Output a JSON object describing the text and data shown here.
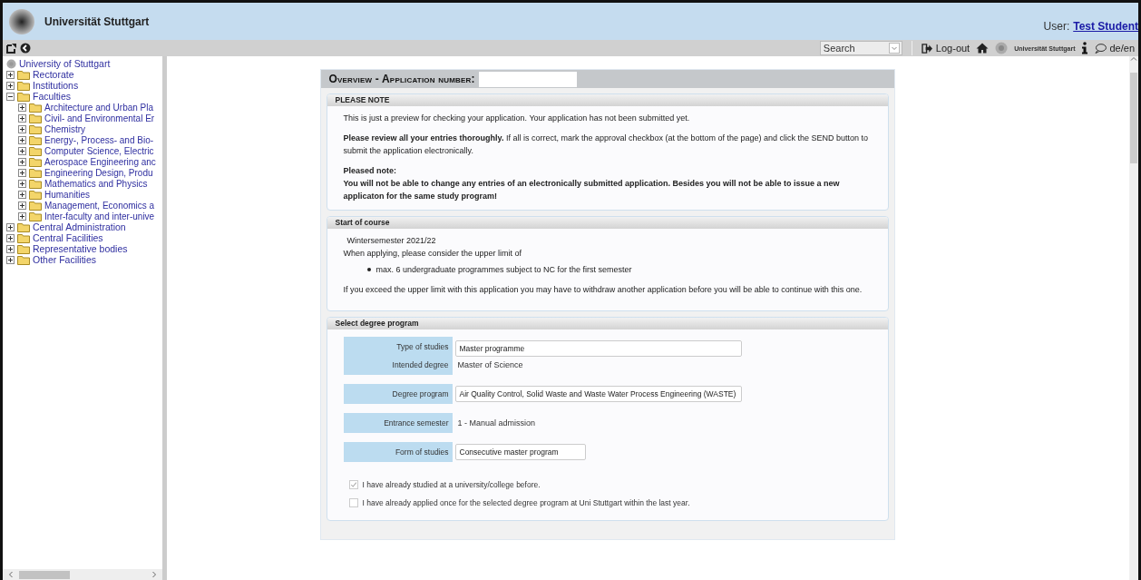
{
  "header": {
    "title": "Universität Stuttgart",
    "user_label": "User:",
    "user_name": "Test Student"
  },
  "toolbar": {
    "search": {
      "value": "Search"
    },
    "logout": "Log-out",
    "logo_text": "Universität Stuttgart",
    "language": "de/en"
  },
  "sidebar": {
    "root": "University of Stuttgart",
    "items": [
      {
        "label": "Rectorate",
        "expanded": false
      },
      {
        "label": "Institutions",
        "expanded": false
      },
      {
        "label": "Faculties",
        "expanded": true,
        "children": [
          {
            "label": "Architecture and Urban Pla",
            "expanded": false
          },
          {
            "label": "Civil- and Environmental Er",
            "expanded": false
          },
          {
            "label": "Chemistry",
            "expanded": false
          },
          {
            "label": "Energy-, Process- and Bio-",
            "expanded": false
          },
          {
            "label": "Computer Science, Electric",
            "expanded": false
          },
          {
            "label": "Aerospace Engineering anc",
            "expanded": false
          },
          {
            "label": "Engineering Design, Produ",
            "expanded": false
          },
          {
            "label": "Mathematics and Physics",
            "expanded": false
          },
          {
            "label": "Humanities",
            "expanded": false
          },
          {
            "label": "Management, Economics a",
            "expanded": false
          },
          {
            "label": "Inter-faculty and inter-unive",
            "expanded": false
          }
        ]
      },
      {
        "label": "Central Administration",
        "expanded": false
      },
      {
        "label": "Central Facilities",
        "expanded": false
      },
      {
        "label": "Representative bodies",
        "expanded": false
      },
      {
        "label": "Other Facilities",
        "expanded": false
      }
    ]
  },
  "overview": {
    "title": "Overview - Application number:"
  },
  "notice": {
    "title": "PLEASE NOTE",
    "intro": "This is just a preview for checking your application. Your application has not been submitted yet.",
    "review": "**Please review all your entries thoroughly.** If all is correct, mark the approval checkbox (at the bottom of the page) and click the SEND button to submit the application electronically.",
    "warning_title": "Pleased note:",
    "warning": "You will not be able to change any entries of an electronically submitted application. Besides you will not be able to issue a new applicaton for the same study program!"
  },
  "start": {
    "title": "Start of course",
    "semester": "Wintersemester 2021/22",
    "intro": "When applying, please consider the upper limit of",
    "bullets": [
      "max. 6 undergraduate programmes subject to NC for the first semester"
    ],
    "outro": "If you exceed the upper limit with this application you may have to withdraw another application before you will be able to continue with this one."
  },
  "degree": {
    "title": "Select degree program",
    "groups": [
      {
        "rows": [
          {
            "label": "Type of studies",
            "kind": "field",
            "value": "Master programme"
          },
          {
            "label": "Intended degree",
            "kind": "text",
            "value": "Master of Science"
          }
        ]
      },
      {
        "rows": [
          {
            "label": "Degree program",
            "kind": "field",
            "value": "Air Quality Control, Solid Waste and Waste Water Process Engineering (WASTE)"
          }
        ]
      },
      {
        "rows": [
          {
            "label": "Entrance semester",
            "kind": "text",
            "value": "1 - Manual admission"
          }
        ]
      },
      {
        "rows": [
          {
            "label": "Form of studies",
            "kind": "shortfield",
            "value": "Consecutive master program"
          }
        ]
      }
    ],
    "checks": [
      {
        "label": "I have already studied at a university/college before.",
        "checked": true
      },
      {
        "label": "I have already applied once for the selected degree program at Uni Stuttgart within the last year.",
        "checked": false
      }
    ]
  }
}
